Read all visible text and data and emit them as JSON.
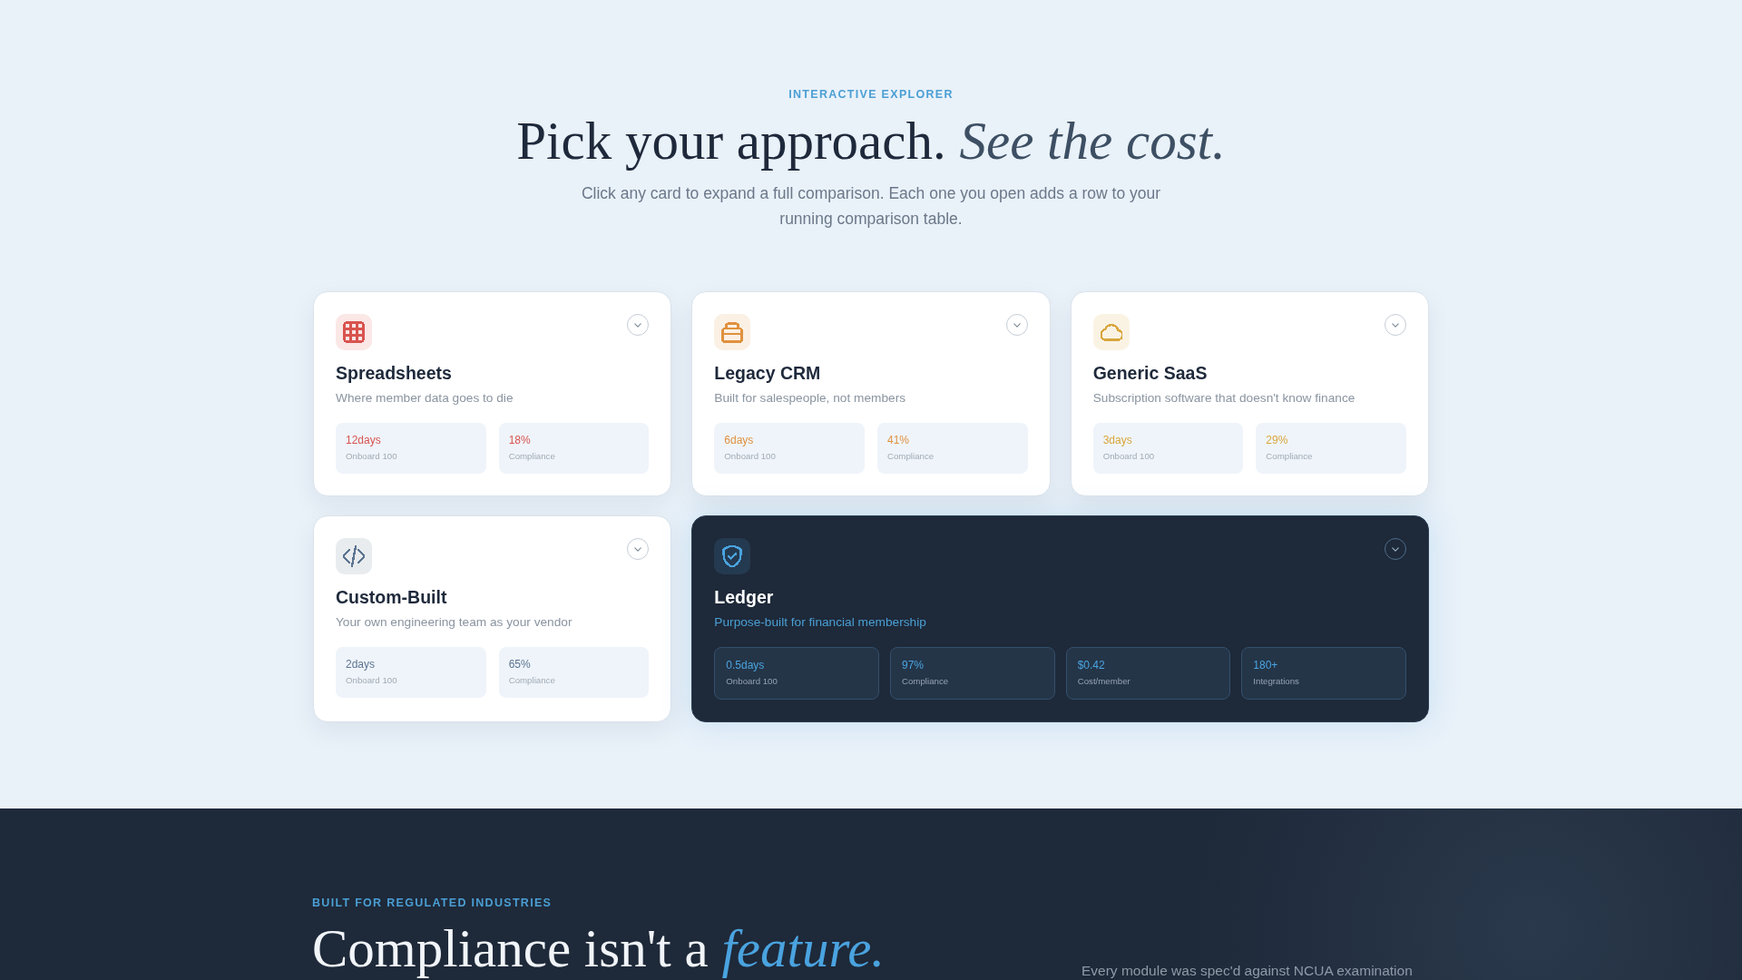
{
  "explorer": {
    "eyebrow": "INTERACTIVE EXPLORER",
    "title": "Pick your approach. *See the cost.*",
    "subtitle": "Click any card to expand a full comparison. Each one you open adds a row to your running comparison table."
  },
  "cards": [
    {
      "title": "Spreadsheets",
      "description": "Where member data goes to die",
      "color": "#d9534f",
      "featured": false,
      "expanded": false,
      "stats": [
        {
          "value": "12days",
          "label": "Onboard 100"
        },
        {
          "value": "18%",
          "label": "Compliance"
        }
      ]
    },
    {
      "title": "Legacy CRM",
      "description": "Built for salespeople, not members",
      "color": "#e0913e",
      "featured": false,
      "expanded": false,
      "stats": [
        {
          "value": "6days",
          "label": "Onboard 100"
        },
        {
          "value": "41%",
          "label": "Compliance"
        }
      ]
    },
    {
      "title": "Generic SaaS",
      "description": "Subscription software that doesn't know finance",
      "color": "#d9a63c",
      "featured": false,
      "expanded": false,
      "stats": [
        {
          "value": "3days",
          "label": "Onboard 100"
        },
        {
          "value": "29%",
          "label": "Compliance"
        }
      ]
    },
    {
      "title": "Custom-Built",
      "description": "Your own engineering team as your vendor",
      "color": "#5c7490",
      "featured": false,
      "expanded": false,
      "stats": [
        {
          "value": "2days",
          "label": "Onboard 100"
        },
        {
          "value": "65%",
          "label": "Compliance"
        }
      ]
    },
    {
      "title": "Ledger",
      "description": "Purpose-built for financial membership",
      "color": "#4aa3df",
      "featured": true,
      "expanded": false,
      "stats": [
        {
          "value": "0.5days",
          "label": "Onboard 100"
        },
        {
          "value": "97%",
          "label": "Compliance"
        },
        {
          "value": "$0.42",
          "label": "Cost/member"
        },
        {
          "value": "180+",
          "label": "Integrations"
        }
      ]
    }
  ],
  "compliance": {
    "eyebrow": "BUILT FOR REGULATED INDUSTRIES",
    "heading": "Compliance isn't a *feature.*",
    "description": "Every module was spec'd against NCUA examination"
  }
}
